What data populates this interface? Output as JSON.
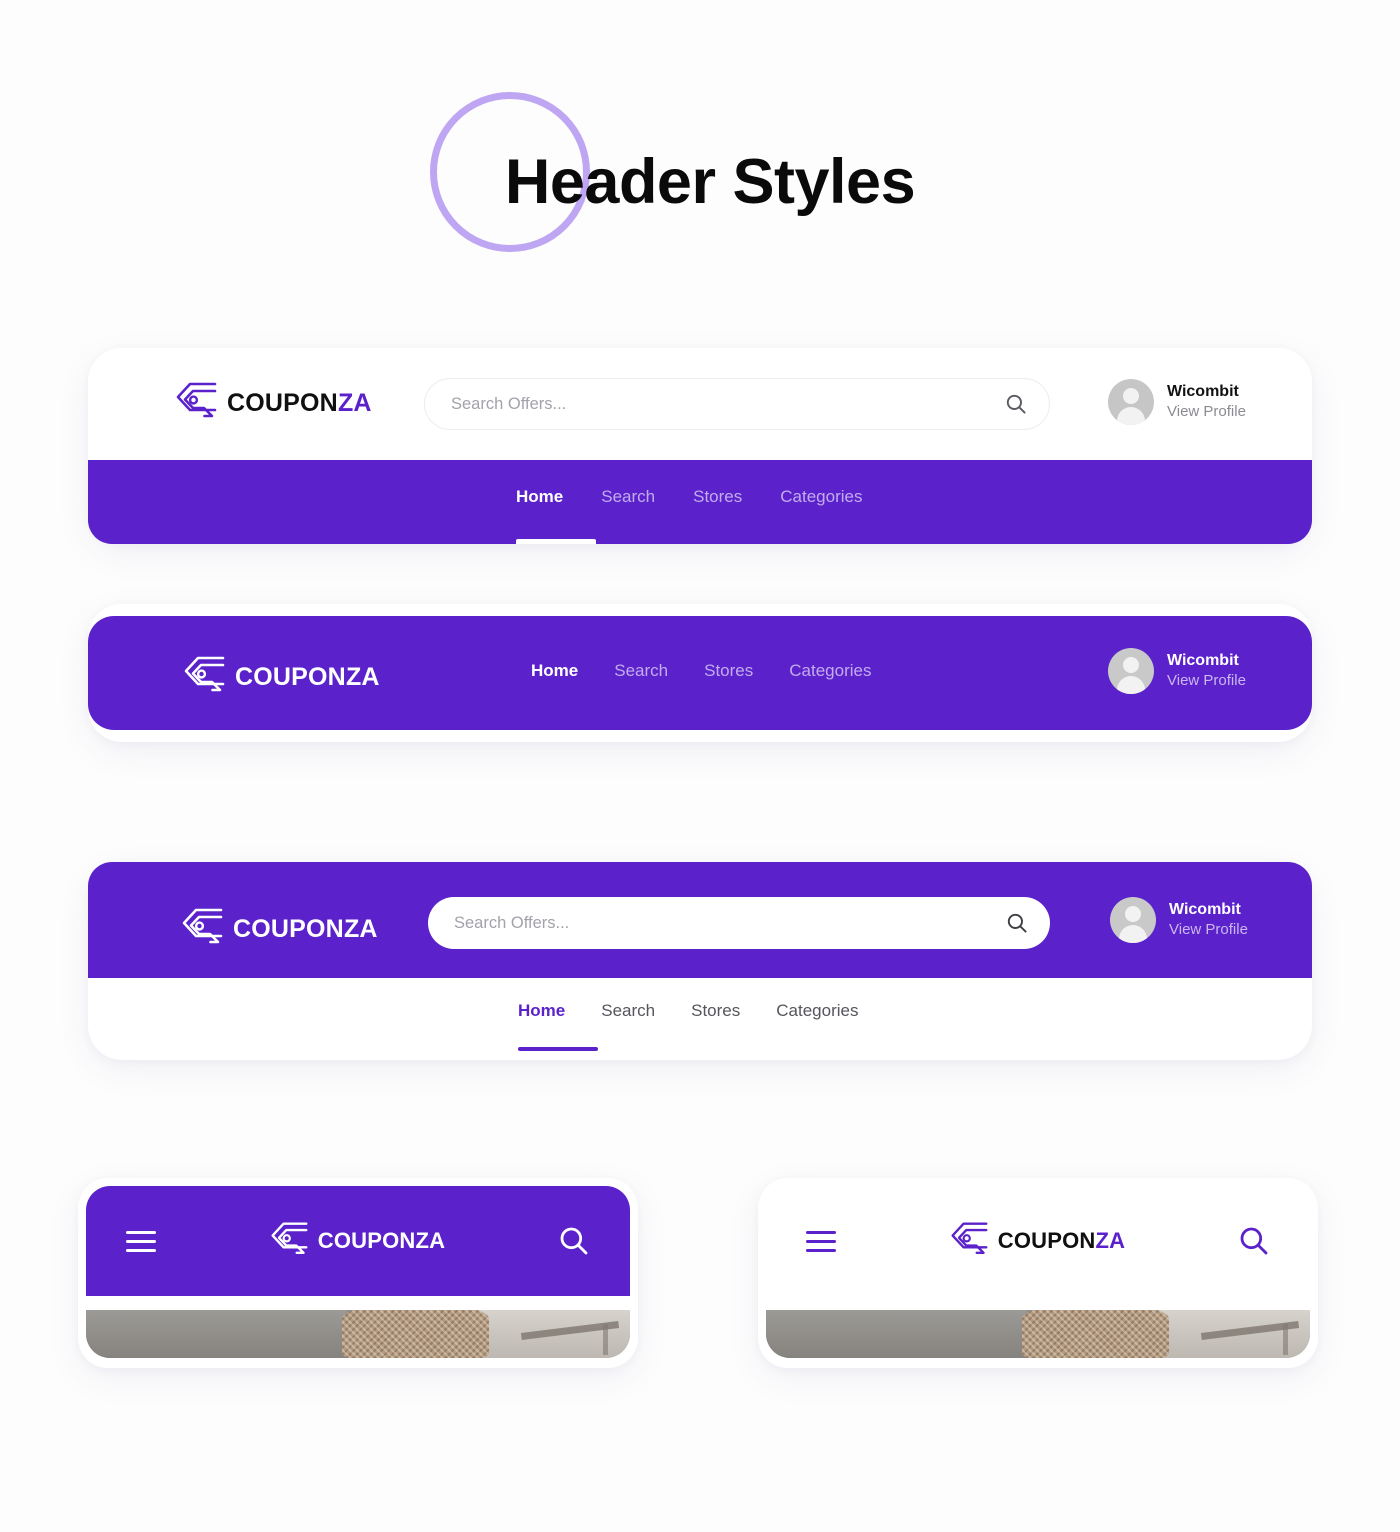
{
  "page": {
    "title": "Header Styles",
    "background": "#fdfdfd",
    "accent_color": "#5b22cc",
    "ring_color": "#bfa6f2"
  },
  "brand": {
    "word_dark": "COUPON",
    "word_accent": "ZA",
    "mark": "coupon-tag-icon"
  },
  "search": {
    "placeholder": "Search Offers...",
    "icon": "search-icon"
  },
  "profile": {
    "name": "Wicombit",
    "subtitle": "View Profile",
    "avatar": "avatar-placeholder-icon"
  },
  "nav": {
    "items": [
      {
        "label": "Home",
        "active": true
      },
      {
        "label": "Search",
        "active": false
      },
      {
        "label": "Stores",
        "active": false
      },
      {
        "label": "Categories",
        "active": false
      }
    ]
  },
  "headers": [
    {
      "id": "header-style-1",
      "description": "White top bar with logo, search and profile; purple nav bar below with white active underline"
    },
    {
      "id": "header-style-2",
      "description": "Single purple pill bar with logo, inline nav and profile"
    },
    {
      "id": "header-style-3",
      "description": "Purple bar with logo, white search and profile; white nav row below with purple active underline"
    }
  ],
  "mobile": [
    {
      "id": "mobile-header-purple",
      "menu_icon": "hamburger-menu-icon",
      "search_icon": "search-icon",
      "style": "purple"
    },
    {
      "id": "mobile-header-white",
      "menu_icon": "hamburger-menu-icon",
      "search_icon": "search-icon",
      "style": "white"
    }
  ]
}
